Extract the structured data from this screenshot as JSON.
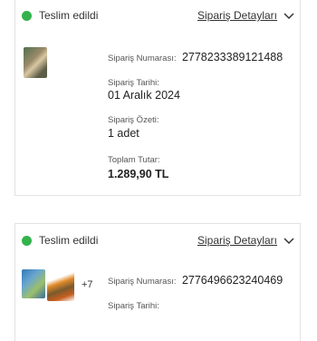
{
  "orders": [
    {
      "status": "Teslim edildi",
      "details_link": "Sipariş Detayları",
      "order_number_label": "Sipariş Numarası:",
      "order_number": "2778233389121488",
      "order_date_label": "Sipariş Tarihi:",
      "order_date": "01 Aralık 2024",
      "summary_label": "Sipariş Özeti:",
      "summary_value": "1 adet",
      "total_label": "Toplam Tutar:",
      "total_value": "1.289,90 TL"
    },
    {
      "status": "Teslim edildi",
      "details_link": "Sipariş Detayları",
      "extra_items": "+7",
      "order_number_label": "Sipariş Numarası:",
      "order_number": "2776496623240469",
      "order_date_label": "Sipariş Tarihi:"
    }
  ],
  "colors": {
    "status_dot": "#34b24c",
    "border": "#e2e2e2"
  },
  "icons": [
    "status-check-icon",
    "chevron-down-icon"
  ]
}
